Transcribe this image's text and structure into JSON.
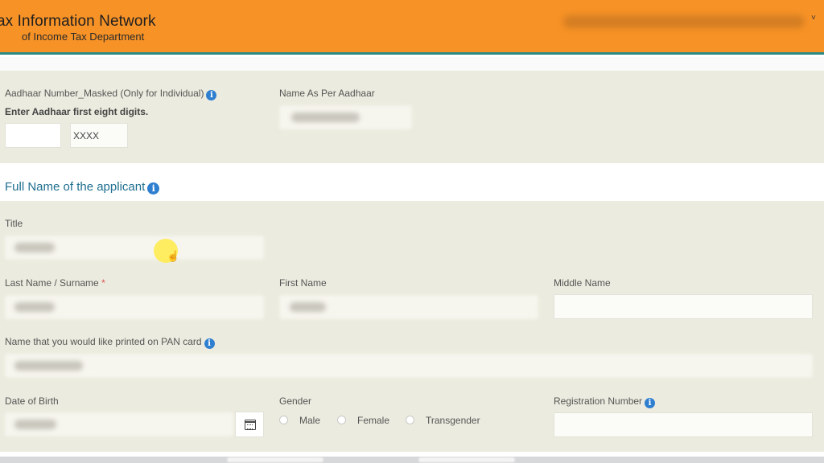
{
  "header": {
    "title": "ax Information Network",
    "subtitle": "of Income Tax Department",
    "menu_chevron": "˅",
    "colors": {
      "bar": "#f79226",
      "underline": "#2b8a86"
    }
  },
  "aadhaar": {
    "number_label": "Aadhaar Number_Masked (Only for Individual)",
    "instruction": "Enter Aadhaar first eight digits.",
    "first_digits_value": "",
    "masked_suffix": "XXXX",
    "name_label": "Name As Per Aadhaar"
  },
  "section": {
    "title": "Full Name of the applicant"
  },
  "form": {
    "title_label": "Title",
    "last_name_label": "Last Name / Surname",
    "required_mark": "*",
    "first_name_label": "First Name",
    "middle_name_label": "Middle Name",
    "middle_name_value": "",
    "pan_name_label": "Name that you would like printed on PAN card",
    "dob_label": "Date of Birth",
    "gender_label": "Gender",
    "gender_options": [
      "Male",
      "Female",
      "Transgender"
    ],
    "registration_label": "Registration Number",
    "registration_value": ""
  },
  "icons": {
    "info": "info-icon",
    "calendar": "calendar-icon",
    "cursor": "hand-cursor-icon",
    "info_glyph": "i",
    "hand_glyph": "☝"
  },
  "colors": {
    "accent": "#2f7fd1",
    "section_title": "#1d6e8f",
    "form_bg": "#ecebdf"
  }
}
